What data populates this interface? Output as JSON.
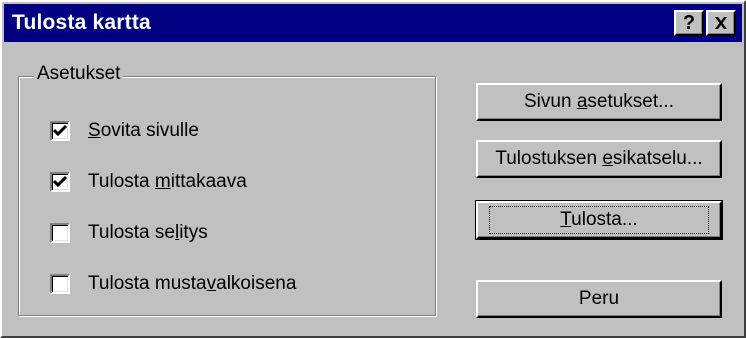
{
  "window": {
    "title": "Tulosta kartta",
    "help_label": "?"
  },
  "settings": {
    "legend": "Asetukset",
    "options": [
      {
        "mnemonic_before": "",
        "mnemonic": "S",
        "mnemonic_after": "ovita sivulle",
        "checked": true
      },
      {
        "mnemonic_before": "Tulosta ",
        "mnemonic": "m",
        "mnemonic_after": "ittakaava",
        "checked": true
      },
      {
        "mnemonic_before": "Tulosta se",
        "mnemonic": "l",
        "mnemonic_after": "itys",
        "checked": false
      },
      {
        "mnemonic_before": "Tulosta musta",
        "mnemonic": "v",
        "mnemonic_after": "alkoisena",
        "checked": false
      }
    ]
  },
  "buttons": {
    "page_setup": {
      "before": "Sivun ",
      "mnemonic": "a",
      "after": "setukset..."
    },
    "print_preview": {
      "before": "Tulostuksen ",
      "mnemonic": "e",
      "after": "sikatselu..."
    },
    "print": {
      "before": "",
      "mnemonic": "T",
      "after": "ulosta..."
    },
    "cancel": {
      "label": "Peru"
    }
  }
}
